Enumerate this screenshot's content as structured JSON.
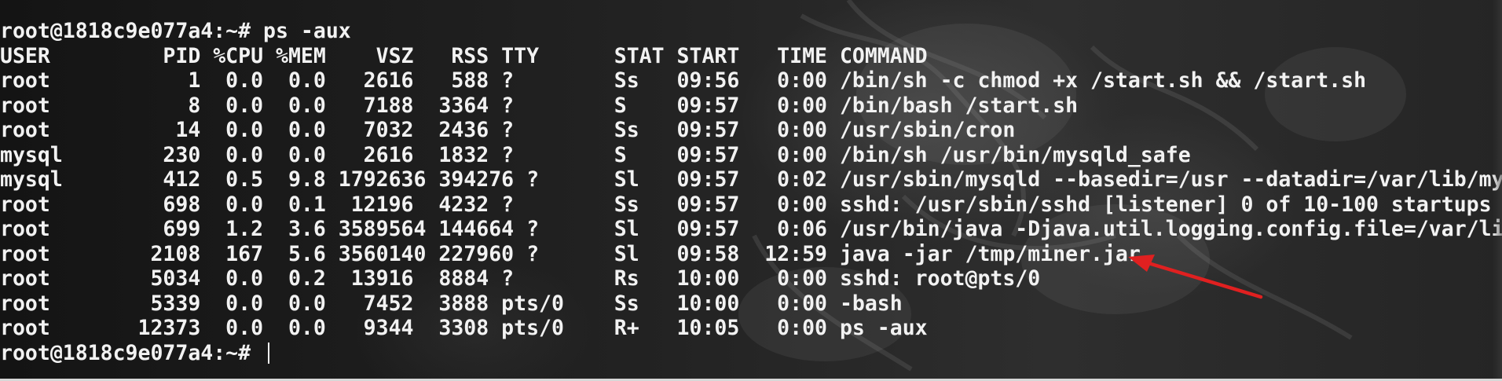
{
  "terminal": {
    "lines": [
      "root@1818c9e077a4:~# ps -aux",
      "USER         PID %CPU %MEM    VSZ   RSS TTY      STAT START   TIME COMMAND",
      "root           1  0.0  0.0   2616   588 ?        Ss   09:56   0:00 /bin/sh -c chmod +x /start.sh && /start.sh",
      "root           8  0.0  0.0   7188  3364 ?        S    09:57   0:00 /bin/bash /start.sh",
      "root          14  0.0  0.0   7032  2436 ?        Ss   09:57   0:00 /usr/sbin/cron",
      "mysql        230  0.0  0.0   2616  1832 ?        S    09:57   0:00 /bin/sh /usr/bin/mysqld_safe",
      "mysql        412  0.5  9.8 1792636 394276 ?      Sl   09:57   0:02 /usr/sbin/mysqld --basedir=/usr --datadir=/var/lib/my",
      "root         698  0.0  0.1  12196  4232 ?        Ss   09:57   0:00 sshd: /usr/sbin/sshd [listener] 0 of 10-100 startups",
      "root         699  1.2  3.6 3589564 144664 ?      Sl   09:57   0:06 /usr/bin/java -Djava.util.logging.config.file=/var/li",
      "root        2108  167  5.6 3560140 227960 ?      Sl   09:58  12:59 java -jar /tmp/miner.jar",
      "root        5034  0.0  0.2  13916  8884 ?        Rs   10:00   0:00 sshd: root@pts/0",
      "root        5339  0.0  0.0   7452  3888 pts/0    Ss   10:00   0:00 -bash",
      "root       12373  0.0  0.0   9344  3308 pts/0    R+   10:05   0:00 ps -aux"
    ],
    "prompt": "root@1818c9e077a4:~# "
  },
  "annotation": {
    "arrow_color": "#e02020",
    "target": "java -jar /tmp/miner.jar"
  }
}
